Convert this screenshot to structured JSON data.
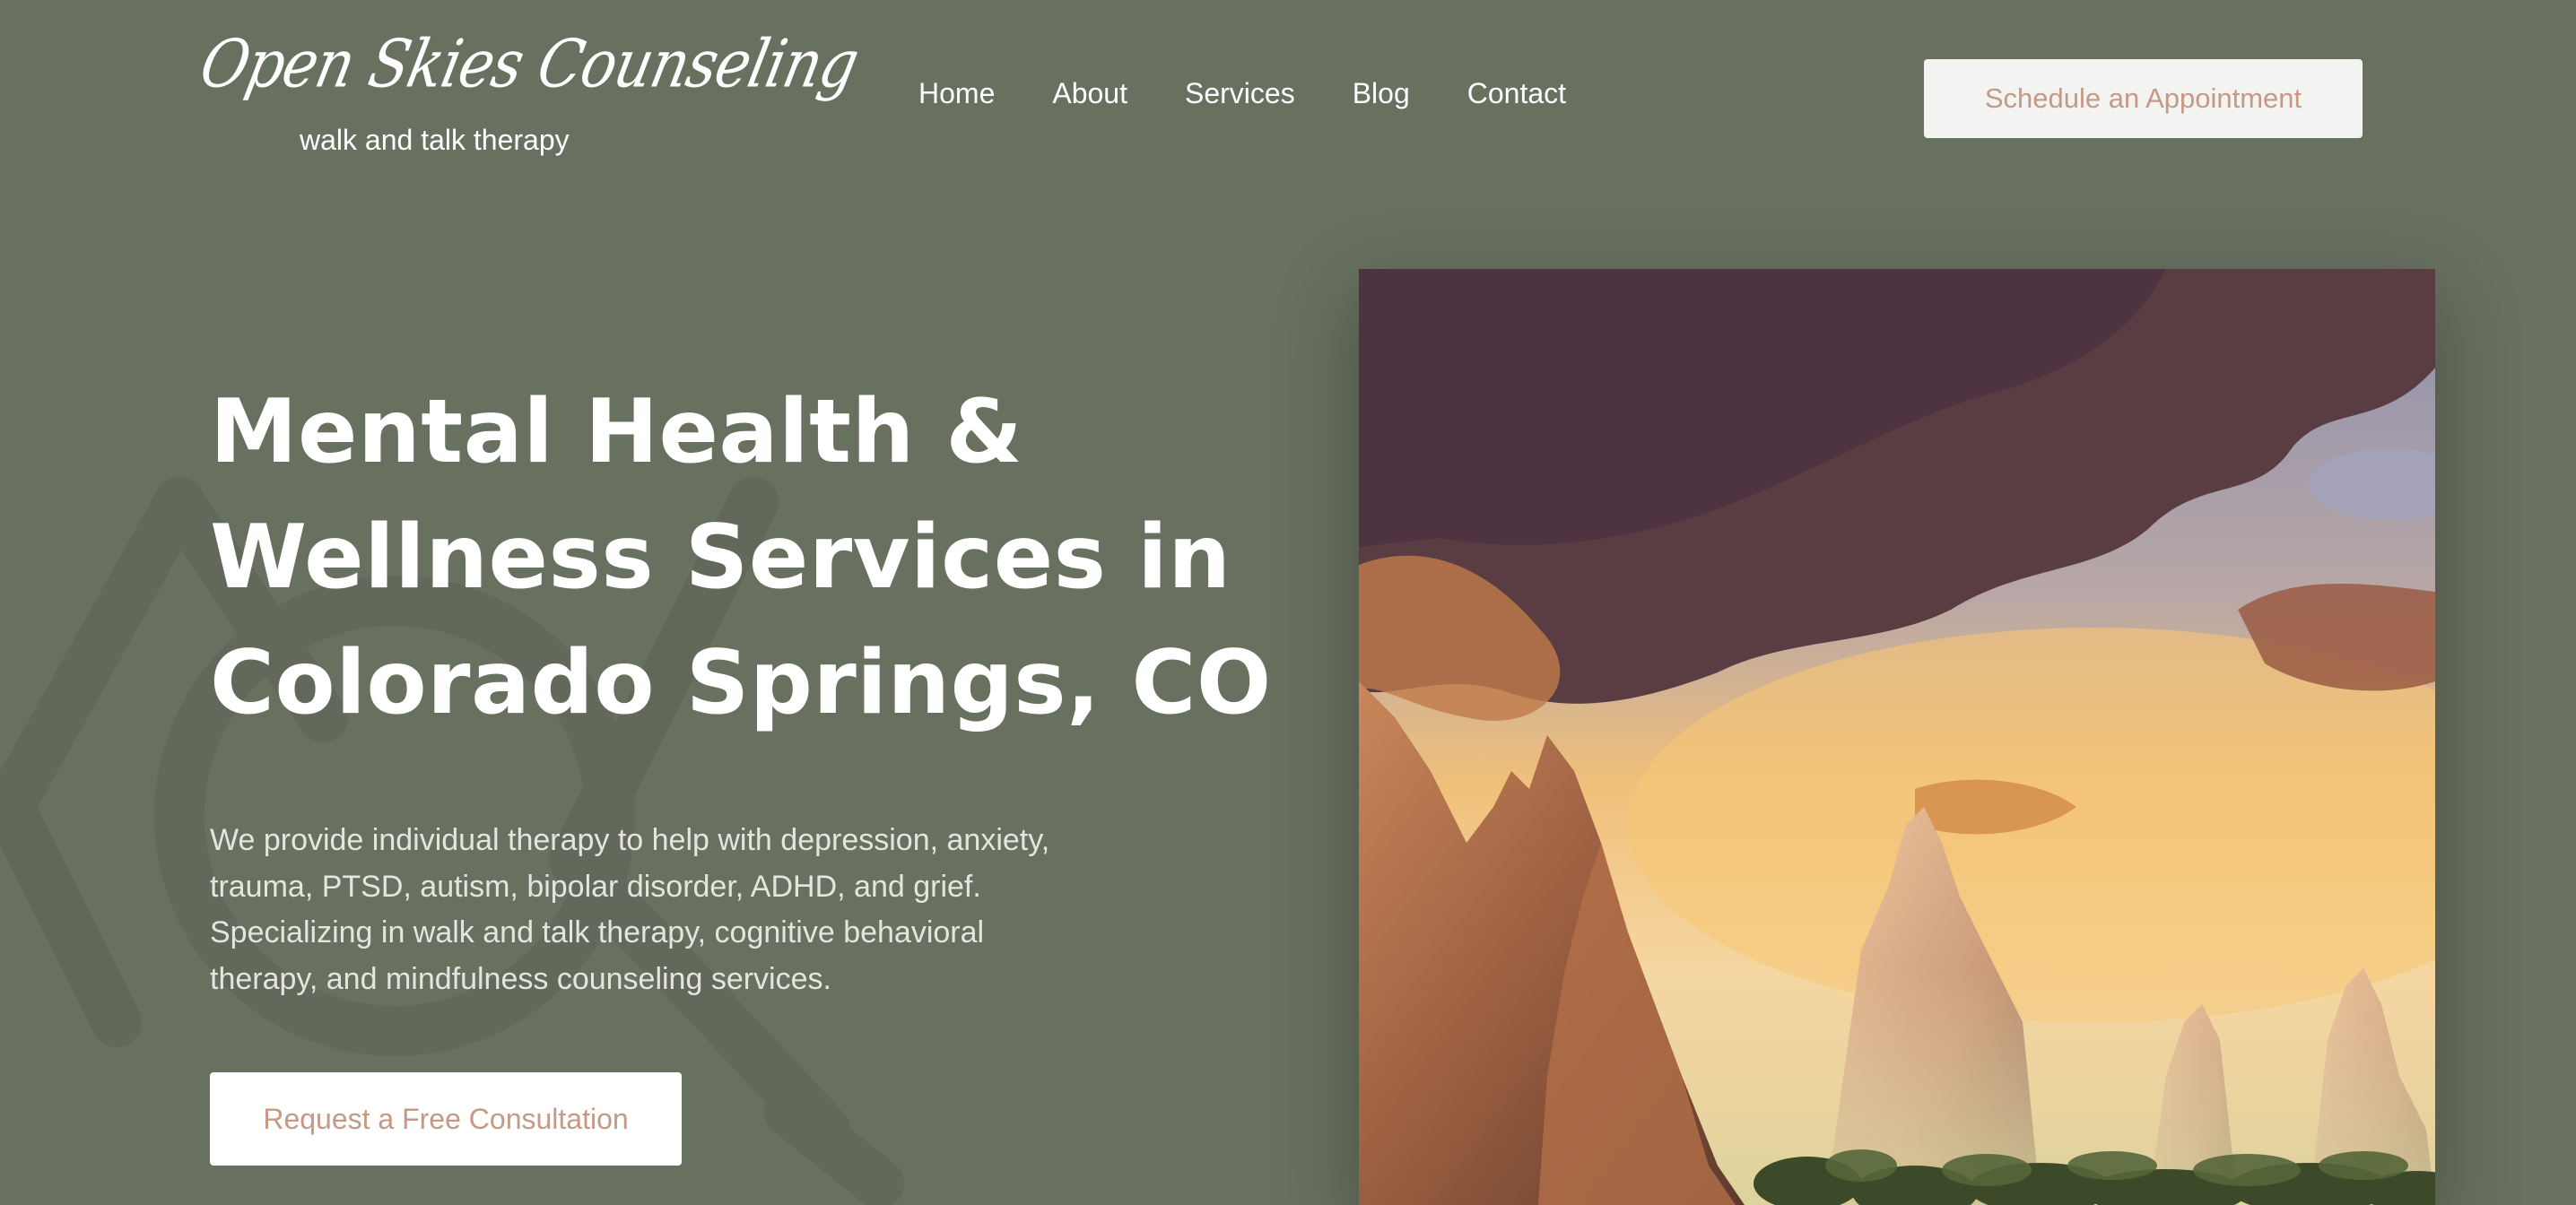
{
  "header": {
    "logo_script": "Open Skies Counseling",
    "logo_tagline": "walk and talk therapy",
    "nav": [
      {
        "label": "Home"
      },
      {
        "label": "About"
      },
      {
        "label": "Services"
      },
      {
        "label": "Blog"
      },
      {
        "label": "Contact"
      }
    ],
    "cta_label": "Schedule an Appointment"
  },
  "hero": {
    "title_lines": [
      "Mental Health &",
      "Wellness Services in",
      "Colorado Springs, CO"
    ],
    "description_lines": [
      "We provide individual therapy to help with depression, anxiety,",
      "trauma, PTSD, autism, bipolar disorder, ADHD, and grief.",
      "Specializing in walk and talk therapy, cognitive behavioral",
      "therapy, and mindfulness counseling services."
    ],
    "cta_label": "Request a Free Consultation",
    "image_icon": "mountain-sunset-photo"
  },
  "colors": {
    "background": "#687060",
    "button_bg": "#f3f3f2",
    "button_text": "#c49a86",
    "text": "#ffffff"
  }
}
